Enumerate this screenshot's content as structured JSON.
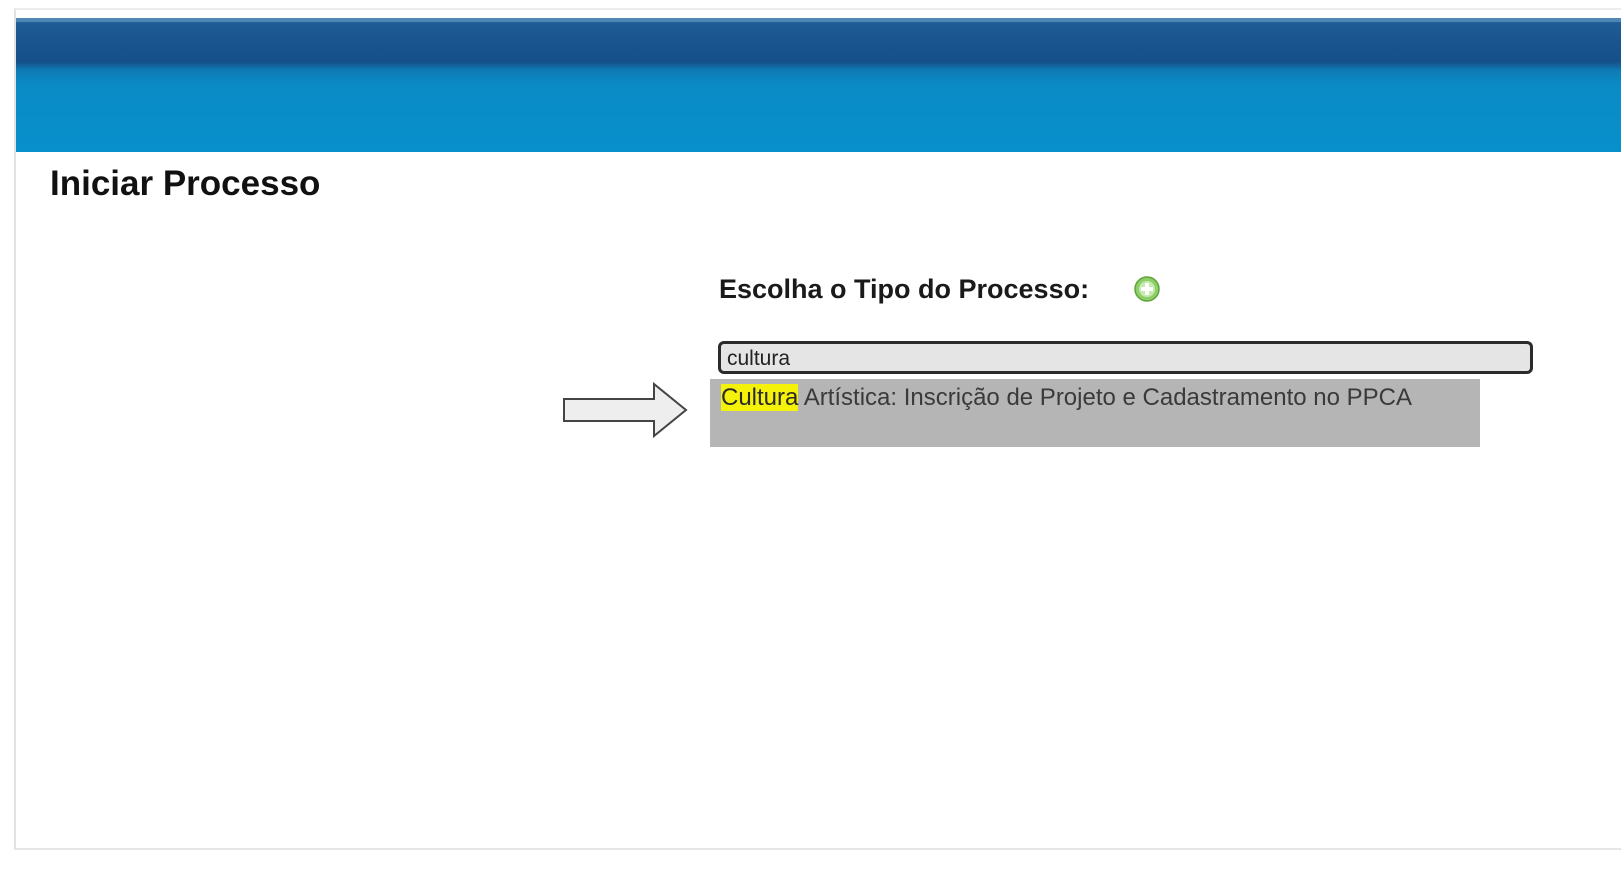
{
  "page": {
    "title": "Iniciar Processo"
  },
  "form": {
    "label": "Escolha o Tipo do Processo:",
    "search_value": "cultura",
    "add_icon": "green-plus-circle-icon"
  },
  "autocomplete": {
    "items": [
      {
        "match": "Cultura",
        "rest": " Artística: Inscrição de Projeto e Cadastramento no PPCA"
      }
    ]
  },
  "annotation": {
    "arrow_icon": "right-arrow-icon"
  },
  "colors": {
    "header_dark": "#1a5590",
    "header_light": "#0890cc",
    "highlight": "#f4f20a",
    "dropdown_bg": "#b5b5b5",
    "input_bg": "#e5e5e5"
  }
}
